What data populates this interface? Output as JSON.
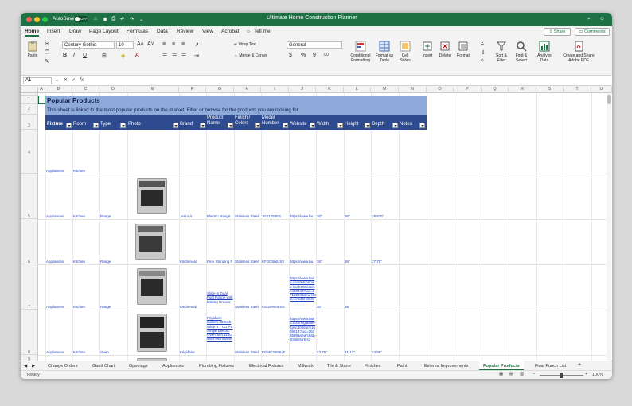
{
  "window": {
    "title": "Ultimate Home Construction Planner",
    "autosave_label": "AutoSave",
    "autosave_state": "OFF",
    "colors": {
      "titlebar": "#1e7145",
      "header_band": "#8eaadb",
      "header_row": "#2f4b8f",
      "link": "#1f3fbf"
    }
  },
  "ribbon_tabs": [
    "Home",
    "Insert",
    "Draw",
    "Page Layout",
    "Formulas",
    "Data",
    "Review",
    "View",
    "Acrobat"
  ],
  "tell_me": "Tell me",
  "share_label": "Share",
  "comments_label": "Comments",
  "ribbon": {
    "paste": "Paste",
    "font_name": "Century Gothic",
    "font_size": "10",
    "wrap_text": "Wrap Text",
    "merge_center": "Merge & Center",
    "number_format": "General",
    "conditional_formatting": "Conditional Formatting",
    "format_as_table": "Format as Table",
    "cell_styles": "Cell Styles",
    "insert": "Insert",
    "delete": "Delete",
    "format": "Format",
    "sort_filter": "Sort & Filter",
    "find_select": "Find & Select",
    "analyze_data": "Analyze Data",
    "create_share_pdf": "Create and Share Adobe PDF"
  },
  "formula_bar": {
    "name_box": "A1",
    "fx": "fx",
    "value": ""
  },
  "columns": [
    "A",
    "B",
    "C",
    "D",
    "E",
    "F",
    "G",
    "H",
    "I",
    "J",
    "K",
    "L",
    "M",
    "N",
    "O",
    "P",
    "Q",
    "R",
    "S",
    "T",
    "U"
  ],
  "sheet": {
    "title": "Popular Products",
    "subtitle": "This sheet is linked to the most popular products on the market. Filter or browse for the products you are looking for.",
    "headers": [
      "Fixture",
      "Room",
      "Type",
      "Photo",
      "Brand",
      "Product Name",
      "Finish / Colors",
      "Model Number",
      "Website",
      "Width",
      "Height",
      "Depth",
      "Notes"
    ],
    "row_numbers": [
      "1",
      "2",
      "3",
      "4",
      "5",
      "6",
      "7",
      "8",
      "9"
    ],
    "rows": [
      {
        "fixture": "Appliances",
        "room": "Kitchen",
        "type": "",
        "brand": "",
        "name": "",
        "finish": "",
        "model": "",
        "website": "",
        "width": "",
        "height": "",
        "depth": ""
      },
      {
        "fixture": "Appliances",
        "room": "Kitchen",
        "type": "Range",
        "brand": "JennAir",
        "name": "Electric Range:",
        "finish": "Stainless Steel",
        "model": "JES1750FS",
        "website": "https://www.bu",
        "width": "30\"",
        "height": "36\"",
        "depth": "28.875\""
      },
      {
        "fixture": "Appliances",
        "room": "Kitchen",
        "type": "Range",
        "brand": "KitchenAid",
        "name": "Free Standing F",
        "finish": "Stainless Steel",
        "model": "KFGC506JSS",
        "website": "https://www.bu",
        "width": "36\"",
        "height": "36\"",
        "depth": "27.75\""
      },
      {
        "fixture": "Appliances",
        "room": "Kitchen",
        "type": "Range",
        "brand": "KitchenAid",
        "name": "Slide-In Dual Fuel Range with Baking Drawer",
        "finish": "Stainless Steel",
        "model": "KSDB900ESS",
        "website": "https://www.build.com/kitchenaid-ksdb900ess/s1490443?uid=2712224&searchId=1Ak45HCkrs",
        "width": "30\"",
        "height": "36\"",
        "depth": ""
      },
      {
        "fixture": "Appliances",
        "room": "Kitchen",
        "type": "Oven",
        "brand": "Frigidaire",
        "name": "Frigidaire Gallery 30 Inch Wide 6.7 Cu. Ft. Single Electric Oven with 1150 Watt Microwave",
        "finish": "Stainless Steel",
        "model": "FGMC3066UF",
        "website": "https://www.build.com/frigidaire-fgmc3066uf/s1659814?uid=2925588&searchId=GfskE5Yhm2",
        "width": "23.75\"",
        "height": "41.12\"",
        "depth": "24.88\""
      }
    ]
  },
  "sheet_tabs": [
    "Change Orders",
    "Gantt Chart",
    "Openings",
    "Appliances",
    "Plumbing Fixtures",
    "Electrical Fixtures",
    "Millwork",
    "Tile & Stone",
    "Finishes",
    "Paint",
    "Exterior Improvements",
    "Popular Products",
    "Final Punch List"
  ],
  "active_tab": "Popular Products",
  "status": {
    "ready": "Ready",
    "zoom": "100%"
  }
}
